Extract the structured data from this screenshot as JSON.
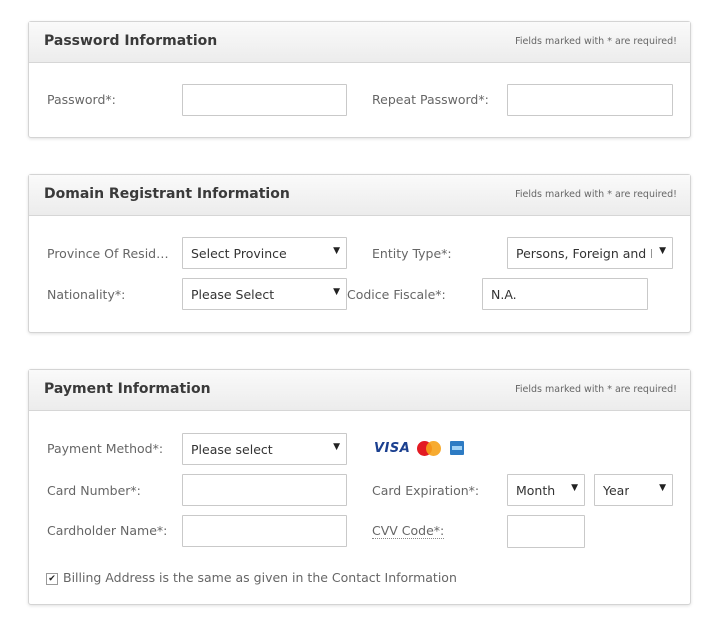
{
  "password_section": {
    "title": "Password Information",
    "note": "Fields marked with * are required!",
    "password_label": "Password*:",
    "password_value": "",
    "repeat_label": "Repeat Password*:",
    "repeat_value": ""
  },
  "registrant_section": {
    "title": "Domain Registrant Information",
    "note": "Fields marked with * are required!",
    "province_label": "Province Of Residence*:",
    "province_value": "Select Province",
    "entity_label": "Entity Type*:",
    "entity_value": "Persons, Foreign and It",
    "nationality_label": "Nationality*:",
    "nationality_value": "Please Select",
    "codice_label": "Codice Fiscale*:",
    "codice_value": "N.A."
  },
  "payment_section": {
    "title": "Payment Information",
    "note": "Fields marked with * are required!",
    "method_label": "Payment Method*:",
    "method_value": "Please select",
    "card_logos": {
      "visa": "VISA",
      "mastercard": "MasterCard",
      "amex": "American Express"
    },
    "card_number_label": "Card Number*:",
    "card_number_value": "",
    "expiration_label": "Card Expiration*:",
    "month_value": "Month",
    "year_value": "Year",
    "cardholder_label": "Cardholder Name*:",
    "cardholder_value": "",
    "cvv_label": "CVV Code*:",
    "cvv_value": "",
    "billing_checked": true,
    "billing_label": "Billing Address is the same as given in the Contact Information"
  },
  "icons": {
    "dropdown": "caret-down",
    "check": "checkmark"
  },
  "colors": {
    "visa_blue": "#1a3f8f",
    "mc_red": "#e31b23",
    "mc_orange": "#f6a21a",
    "amex_blue": "#2d7bc3"
  }
}
